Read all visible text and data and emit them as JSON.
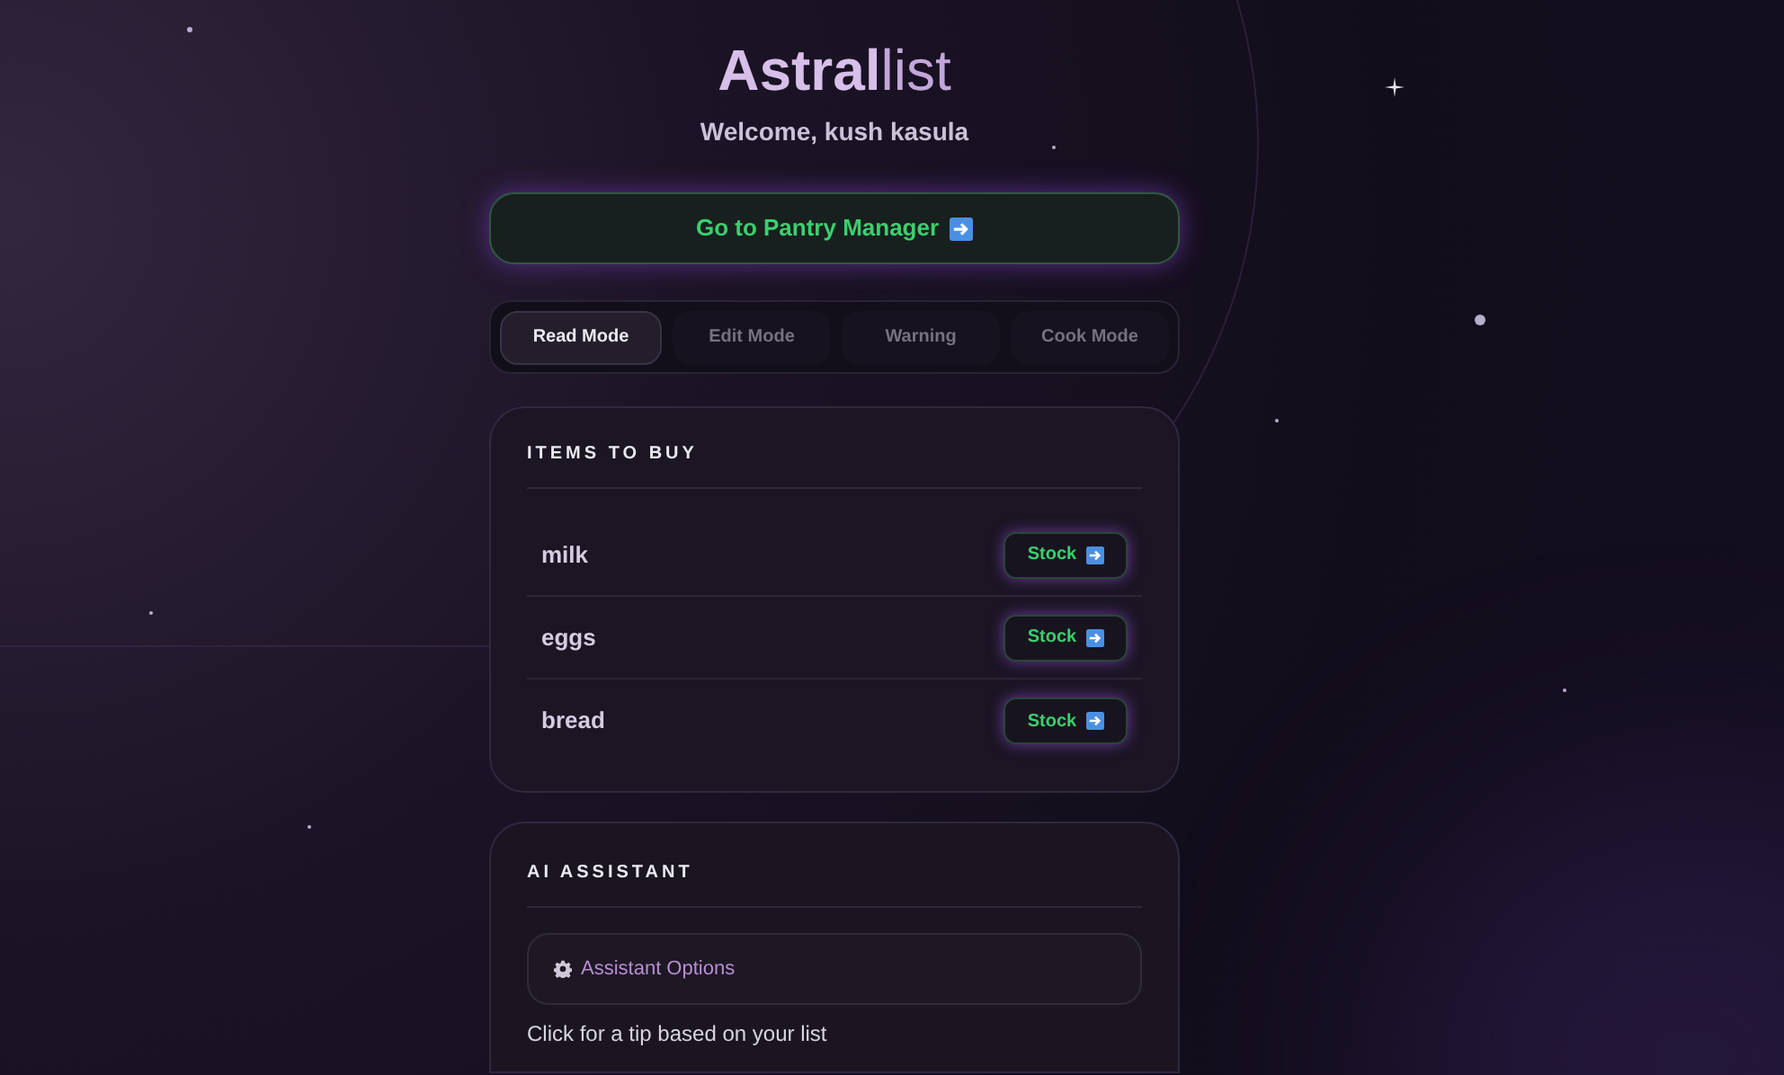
{
  "app": {
    "title_bold": "Astral",
    "title_light": "list",
    "welcome": "Welcome, kush kasula"
  },
  "pantry_button": {
    "label": "Go to Pantry Manager"
  },
  "tabs": [
    {
      "label": "Read Mode",
      "selected": true
    },
    {
      "label": "Edit Mode",
      "selected": false
    },
    {
      "label": "Warning",
      "selected": false
    },
    {
      "label": "Cook Mode",
      "selected": false
    }
  ],
  "items_card": {
    "title": "ITEMS TO BUY",
    "items": [
      {
        "name": "milk",
        "button": "Stock"
      },
      {
        "name": "eggs",
        "button": "Stock"
      },
      {
        "name": "bread",
        "button": "Stock"
      }
    ]
  },
  "assistant_card": {
    "title": "AI ASSISTANT",
    "options_label": "Assistant Options",
    "hint": "Click for a tip based on your list"
  }
}
